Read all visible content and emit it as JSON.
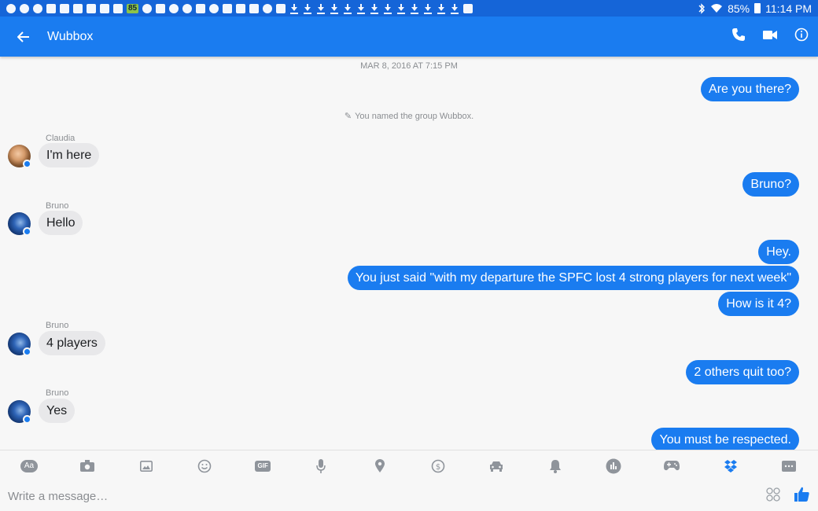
{
  "status_bar": {
    "badge": "85",
    "battery": "85%",
    "time": "11:14 PM"
  },
  "header": {
    "title": "Wubbox",
    "icons": [
      "back-arrow-icon",
      "phone-icon",
      "video-camera-icon",
      "info-icon"
    ]
  },
  "thread": {
    "timestamp": "MAR 8, 2016 AT 7:15 PM",
    "system_note": "You named the group Wubbox.",
    "messages": [
      {
        "from": "me",
        "text": "Are you there?"
      },
      {
        "from": "Claudia",
        "sender_label": "Claudia",
        "text": "I'm here"
      },
      {
        "from": "me",
        "text": "Bruno?"
      },
      {
        "from": "Bruno",
        "sender_label": "Bruno",
        "text": "Hello"
      },
      {
        "from": "me",
        "text": "Hey."
      },
      {
        "from": "me",
        "text": "You just said \"with my departure the SPFC lost 4 strong players for next week\""
      },
      {
        "from": "me",
        "text": "How is it 4?"
      },
      {
        "from": "Bruno",
        "sender_label": "Bruno",
        "text": "4 players"
      },
      {
        "from": "me",
        "text": "2 others quit too?"
      },
      {
        "from": "Bruno",
        "sender_label": "Bruno",
        "text": "Yes"
      },
      {
        "from": "me",
        "text": "You must be respected."
      }
    ]
  },
  "toolbar": {
    "text_label": "Aa",
    "gif_label": "GIF",
    "icons": [
      "text-icon",
      "camera-icon",
      "image-icon",
      "emoji-icon",
      "gif-icon",
      "microphone-icon",
      "location-icon",
      "payment-icon",
      "car-icon",
      "bell-icon",
      "poll-icon",
      "game-controller-icon",
      "dropbox-icon",
      "more-icon"
    ]
  },
  "composer": {
    "placeholder": "Write a message…",
    "icons": [
      "sticker-icon",
      "thumbs-up-icon"
    ]
  },
  "colors": {
    "primary": "#1a7cf0",
    "status_bar": "#1565d8",
    "incoming_bubble": "#e8e8ea",
    "background": "#f7f7f7"
  }
}
